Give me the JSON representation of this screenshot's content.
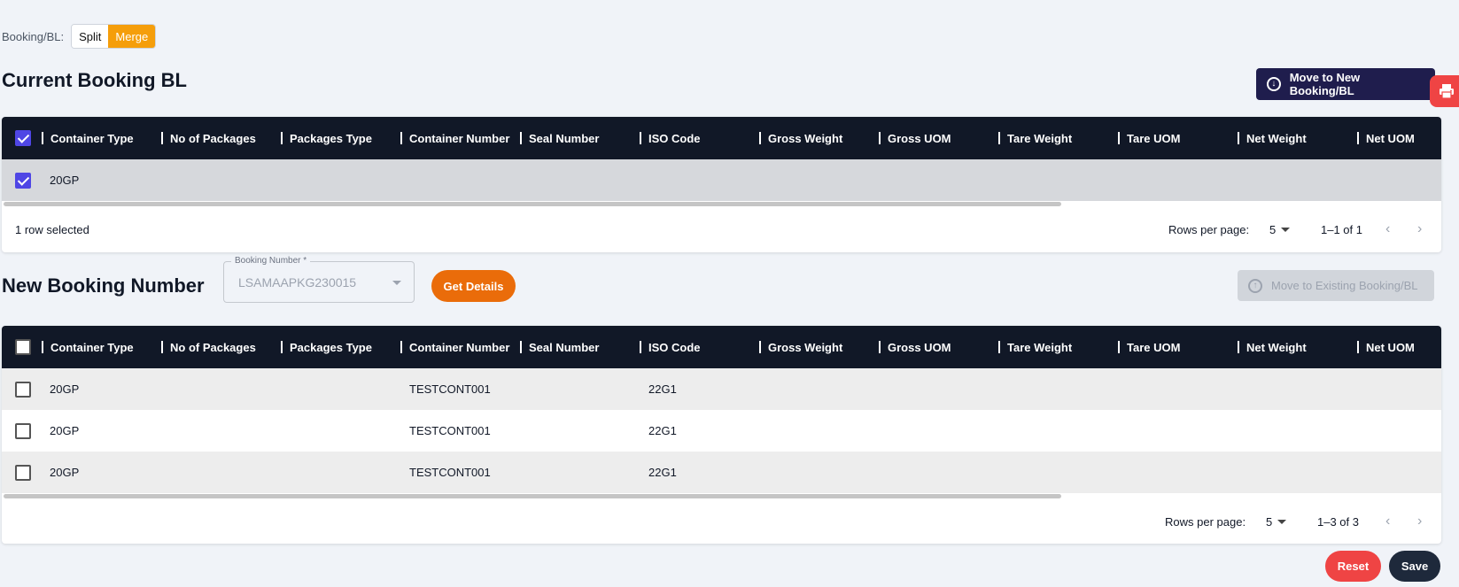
{
  "mode": {
    "label": "Booking/BL:",
    "options": [
      "Split",
      "Merge"
    ],
    "active": "Merge"
  },
  "current": {
    "title": "Current Booking BL",
    "move_button": "Move to New Booking/BL",
    "columns": [
      "Container Type",
      "No of Packages",
      "Packages Type",
      "Container Number",
      "Seal Number",
      "ISO Code",
      "Gross Weight",
      "Gross UOM",
      "Tare Weight",
      "Tare UOM",
      "Net Weight",
      "Net UOM"
    ],
    "header_checked": true,
    "rows": [
      {
        "checked": true,
        "container_type": "20GP",
        "container_number": "",
        "iso_code": ""
      }
    ],
    "selected_text": "1 row selected",
    "rows_per_page_label": "Rows per page:",
    "rows_per_page": "5",
    "range": "1–1 of 1"
  },
  "new": {
    "title": "New Booking Number",
    "booking_label": "Booking Number *",
    "booking_value": "LSAMAAPKG230015",
    "get_details": "Get Details",
    "move_button": "Move to Existing Booking/BL",
    "columns": [
      "Container Type",
      "No of Packages",
      "Packages Type",
      "Container Number",
      "Seal Number",
      "ISO Code",
      "Gross Weight",
      "Gross UOM",
      "Tare Weight",
      "Tare UOM",
      "Net Weight",
      "Net UOM"
    ],
    "header_checked": false,
    "rows": [
      {
        "checked": false,
        "container_type": "20GP",
        "container_number": "TESTCONT001",
        "iso_code": "22G1"
      },
      {
        "checked": false,
        "container_type": "20GP",
        "container_number": "TESTCONT001",
        "iso_code": "22G1"
      },
      {
        "checked": false,
        "container_type": "20GP",
        "container_number": "TESTCONT001",
        "iso_code": "22G1"
      }
    ],
    "rows_per_page_label": "Rows per page:",
    "rows_per_page": "5",
    "range": "1–3 of 3"
  },
  "actions": {
    "reset": "Reset",
    "save": "Save"
  },
  "colors": {
    "accent_orange": "#f59e0b",
    "header_dark": "#111827",
    "button_navy": "#1f1d4d",
    "get_details": "#ea6c0a",
    "reset_red": "#ef4444",
    "save_dark": "#1e293b",
    "checkbox": "#4f46e5"
  },
  "icons": {
    "print": "printer-icon",
    "move_new": "arrow-down-circle-icon",
    "move_existing": "arrow-up-circle-icon"
  }
}
